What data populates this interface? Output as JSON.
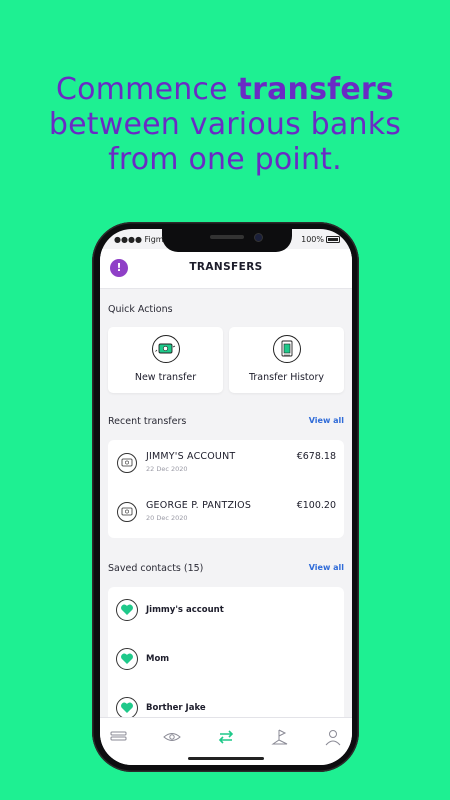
{
  "headline": {
    "part1": "Commence ",
    "highlight": "transfers",
    "line2": "between various banks",
    "line3": "from one point."
  },
  "status": {
    "carrier": "Figma",
    "battery": "100%"
  },
  "header": {
    "title": "TRANSFERS",
    "alert_icon": "exclamation-icon"
  },
  "quick_actions": {
    "label": "Quick Actions",
    "items": [
      {
        "label": "New transfer",
        "icon": "money-transfer-icon"
      },
      {
        "label": "Transfer History",
        "icon": "document-history-icon"
      }
    ]
  },
  "recent_transfers": {
    "label": "Recent transfers",
    "view_all": "View all",
    "items": [
      {
        "name": "JIMMY'S ACCOUNT",
        "date": "22 Dec 2020",
        "amount": "€678.18"
      },
      {
        "name": "GEORGE P. PANTZIOS",
        "date": "20 Dec 2020",
        "amount": "€100.20"
      }
    ]
  },
  "saved_contacts": {
    "label": "Saved contacts (15)",
    "view_all": "View all",
    "items": [
      {
        "name": "Jimmy's account"
      },
      {
        "name": "Mom"
      },
      {
        "name": "Borther Jake"
      }
    ]
  },
  "tabbar": {
    "items": [
      "accounts-icon",
      "eye-icon",
      "transfer-arrows-icon",
      "flag-icon",
      "profile-icon"
    ],
    "active_index": 2
  },
  "colors": {
    "background": "#1ef092",
    "headline": "#6a2bc4",
    "accent_green": "#1fc98a",
    "link_blue": "#2f6bd8",
    "alert_purple": "#8f3fc7"
  }
}
